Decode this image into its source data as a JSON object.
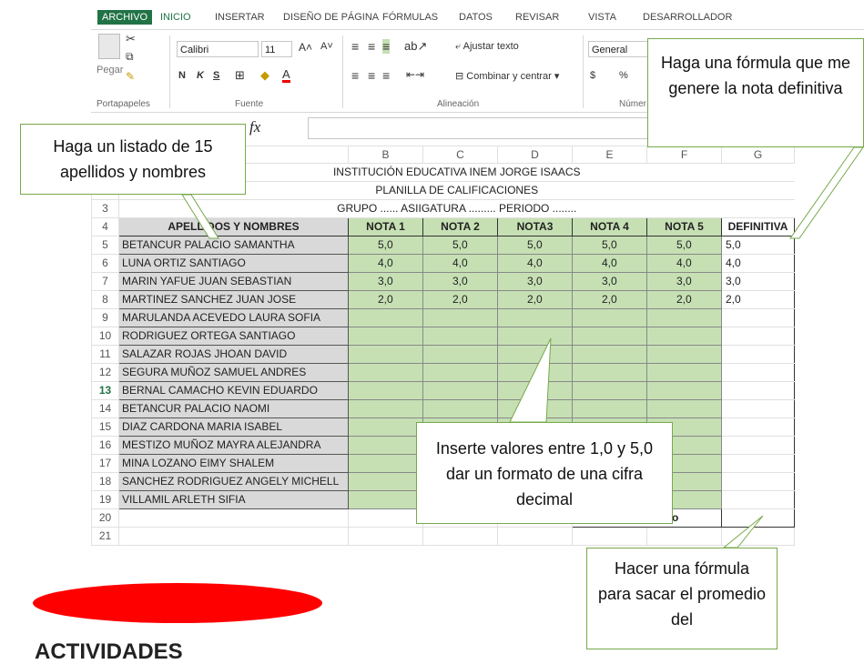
{
  "ribbon": {
    "tabs": [
      "ARCHIVO",
      "INICIO",
      "INSERTAR",
      "DISEÑO DE PÁGINA",
      "FÓRMULAS",
      "DATOS",
      "REVISAR",
      "VISTA",
      "DESARROLLADOR"
    ],
    "paste_label": "Pegar",
    "font_name": "Calibri",
    "font_size": "11",
    "bold": "N",
    "italic": "K",
    "underline": "S",
    "wrap_text": "Ajustar texto",
    "merge_center": "Combinar y centrar",
    "number_format": "General",
    "currency": "$",
    "percent": "%",
    "groups": [
      "Portapapeles",
      "Fuente",
      "Alineación",
      "Númer"
    ]
  },
  "formula_bar": {
    "fx": "fx"
  },
  "sheet": {
    "columns": [
      "B",
      "C",
      "D",
      "E",
      "F",
      "G"
    ],
    "row_numbers": [
      "3",
      "4",
      "5",
      "6",
      "7",
      "8",
      "9",
      "10",
      "11",
      "12",
      "13",
      "14",
      "15",
      "16",
      "17",
      "18",
      "19",
      "20",
      "21"
    ],
    "selected_row": "13",
    "title1": "INSTITUCIÓN EDUCATIVA INEM JORGE ISAACS",
    "title2": "PLANILLA DE CALIFICACIONES",
    "title3": "GRUPO ......  ASIIGATURA .........  PERIODO ........",
    "headers": [
      "APELLIDOS Y NOMBRES",
      "NOTA 1",
      "NOTA 2",
      "NOTA3",
      "NOTA 4",
      "NOTA 5",
      "DEFINITIVA"
    ],
    "names": [
      "BETANCUR PALACIO SAMANTHA",
      "LUNA ORTIZ SANTIAGO",
      "MARIN YAFUE JUAN SEBASTIAN",
      "MARTINEZ SANCHEZ JUAN JOSE",
      "MARULANDA ACEVEDO LAURA SOFIA",
      "RODRIGUEZ ORTEGA SANTIAGO",
      "SALAZAR ROJAS JHOAN DAVID",
      "SEGURA MUÑOZ SAMUEL ANDRES",
      "BERNAL CAMACHO KEVIN EDUARDO",
      "BETANCUR PALACIO NAOMI",
      "DIAZ CARDONA MARIA ISABEL",
      "MESTIZO MUÑOZ MAYRA ALEJANDRA",
      "MINA LOZANO EIMY SHALEM",
      "SANCHEZ RODRIGUEZ ANGELY MICHELL",
      "VILLAMIL ARLETH SIFIA"
    ],
    "grades": [
      [
        "5,0",
        "5,0",
        "5,0",
        "5,0",
        "5,0",
        "5,0"
      ],
      [
        "4,0",
        "4,0",
        "4,0",
        "4,0",
        "4,0",
        "4,0"
      ],
      [
        "3,0",
        "3,0",
        "3,0",
        "3,0",
        "3,0",
        "3,0"
      ],
      [
        "2,0",
        "2,0",
        "2,0",
        "2,0",
        "2,0",
        "2,0"
      ]
    ],
    "promedio_label": "Promedio del grupo"
  },
  "callouts": {
    "names": "Haga un listado de 15 apellidos y nombres",
    "formula": "Haga una fórmula que me genere la nota definitiva",
    "values": "Inserte valores entre 1,0 y 5,0 dar un formato de una cifra decimal",
    "average": "Hacer una fórmula para sacar el promedio del"
  },
  "colors": {
    "excel_green": "#217346",
    "name_fill": "#d9d9d9",
    "grade_fill": "#c6e0b4",
    "callout_border": "#77a94a",
    "red_shape": "#ff0000"
  },
  "footer_text": "ACTIVIDADES"
}
